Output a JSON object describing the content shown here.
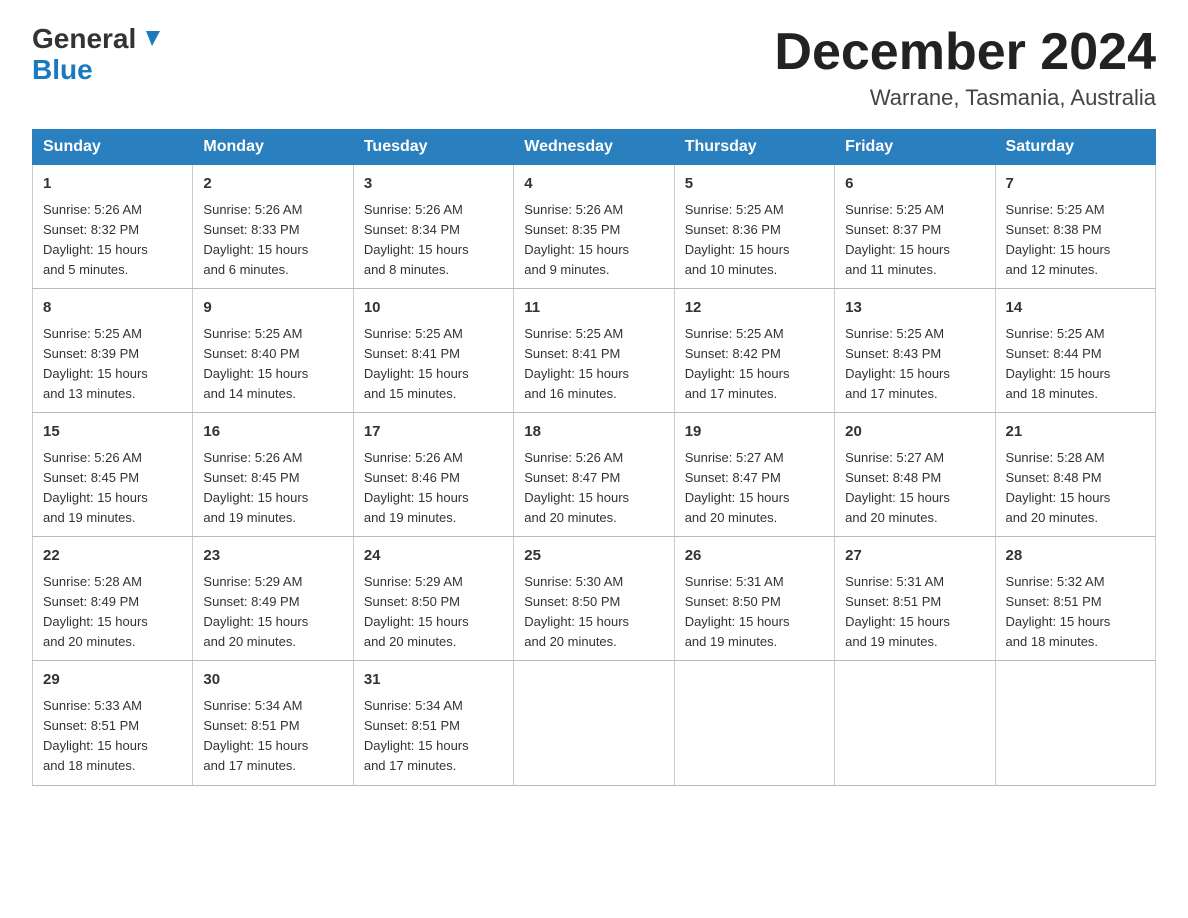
{
  "logo": {
    "text1": "General",
    "text2": "Blue"
  },
  "title": "December 2024",
  "location": "Warrane, Tasmania, Australia",
  "weekdays": [
    "Sunday",
    "Monday",
    "Tuesday",
    "Wednesday",
    "Thursday",
    "Friday",
    "Saturday"
  ],
  "weeks": [
    [
      {
        "day": "1",
        "sunrise": "5:26 AM",
        "sunset": "8:32 PM",
        "daylight": "15 hours and 5 minutes."
      },
      {
        "day": "2",
        "sunrise": "5:26 AM",
        "sunset": "8:33 PM",
        "daylight": "15 hours and 6 minutes."
      },
      {
        "day": "3",
        "sunrise": "5:26 AM",
        "sunset": "8:34 PM",
        "daylight": "15 hours and 8 minutes."
      },
      {
        "day": "4",
        "sunrise": "5:26 AM",
        "sunset": "8:35 PM",
        "daylight": "15 hours and 9 minutes."
      },
      {
        "day": "5",
        "sunrise": "5:25 AM",
        "sunset": "8:36 PM",
        "daylight": "15 hours and 10 minutes."
      },
      {
        "day": "6",
        "sunrise": "5:25 AM",
        "sunset": "8:37 PM",
        "daylight": "15 hours and 11 minutes."
      },
      {
        "day": "7",
        "sunrise": "5:25 AM",
        "sunset": "8:38 PM",
        "daylight": "15 hours and 12 minutes."
      }
    ],
    [
      {
        "day": "8",
        "sunrise": "5:25 AM",
        "sunset": "8:39 PM",
        "daylight": "15 hours and 13 minutes."
      },
      {
        "day": "9",
        "sunrise": "5:25 AM",
        "sunset": "8:40 PM",
        "daylight": "15 hours and 14 minutes."
      },
      {
        "day": "10",
        "sunrise": "5:25 AM",
        "sunset": "8:41 PM",
        "daylight": "15 hours and 15 minutes."
      },
      {
        "day": "11",
        "sunrise": "5:25 AM",
        "sunset": "8:41 PM",
        "daylight": "15 hours and 16 minutes."
      },
      {
        "day": "12",
        "sunrise": "5:25 AM",
        "sunset": "8:42 PM",
        "daylight": "15 hours and 17 minutes."
      },
      {
        "day": "13",
        "sunrise": "5:25 AM",
        "sunset": "8:43 PM",
        "daylight": "15 hours and 17 minutes."
      },
      {
        "day": "14",
        "sunrise": "5:25 AM",
        "sunset": "8:44 PM",
        "daylight": "15 hours and 18 minutes."
      }
    ],
    [
      {
        "day": "15",
        "sunrise": "5:26 AM",
        "sunset": "8:45 PM",
        "daylight": "15 hours and 19 minutes."
      },
      {
        "day": "16",
        "sunrise": "5:26 AM",
        "sunset": "8:45 PM",
        "daylight": "15 hours and 19 minutes."
      },
      {
        "day": "17",
        "sunrise": "5:26 AM",
        "sunset": "8:46 PM",
        "daylight": "15 hours and 19 minutes."
      },
      {
        "day": "18",
        "sunrise": "5:26 AM",
        "sunset": "8:47 PM",
        "daylight": "15 hours and 20 minutes."
      },
      {
        "day": "19",
        "sunrise": "5:27 AM",
        "sunset": "8:47 PM",
        "daylight": "15 hours and 20 minutes."
      },
      {
        "day": "20",
        "sunrise": "5:27 AM",
        "sunset": "8:48 PM",
        "daylight": "15 hours and 20 minutes."
      },
      {
        "day": "21",
        "sunrise": "5:28 AM",
        "sunset": "8:48 PM",
        "daylight": "15 hours and 20 minutes."
      }
    ],
    [
      {
        "day": "22",
        "sunrise": "5:28 AM",
        "sunset": "8:49 PM",
        "daylight": "15 hours and 20 minutes."
      },
      {
        "day": "23",
        "sunrise": "5:29 AM",
        "sunset": "8:49 PM",
        "daylight": "15 hours and 20 minutes."
      },
      {
        "day": "24",
        "sunrise": "5:29 AM",
        "sunset": "8:50 PM",
        "daylight": "15 hours and 20 minutes."
      },
      {
        "day": "25",
        "sunrise": "5:30 AM",
        "sunset": "8:50 PM",
        "daylight": "15 hours and 20 minutes."
      },
      {
        "day": "26",
        "sunrise": "5:31 AM",
        "sunset": "8:50 PM",
        "daylight": "15 hours and 19 minutes."
      },
      {
        "day": "27",
        "sunrise": "5:31 AM",
        "sunset": "8:51 PM",
        "daylight": "15 hours and 19 minutes."
      },
      {
        "day": "28",
        "sunrise": "5:32 AM",
        "sunset": "8:51 PM",
        "daylight": "15 hours and 18 minutes."
      }
    ],
    [
      {
        "day": "29",
        "sunrise": "5:33 AM",
        "sunset": "8:51 PM",
        "daylight": "15 hours and 18 minutes."
      },
      {
        "day": "30",
        "sunrise": "5:34 AM",
        "sunset": "8:51 PM",
        "daylight": "15 hours and 17 minutes."
      },
      {
        "day": "31",
        "sunrise": "5:34 AM",
        "sunset": "8:51 PM",
        "daylight": "15 hours and 17 minutes."
      },
      null,
      null,
      null,
      null
    ]
  ],
  "labels": {
    "sunrise": "Sunrise:",
    "sunset": "Sunset:",
    "daylight": "Daylight:"
  }
}
